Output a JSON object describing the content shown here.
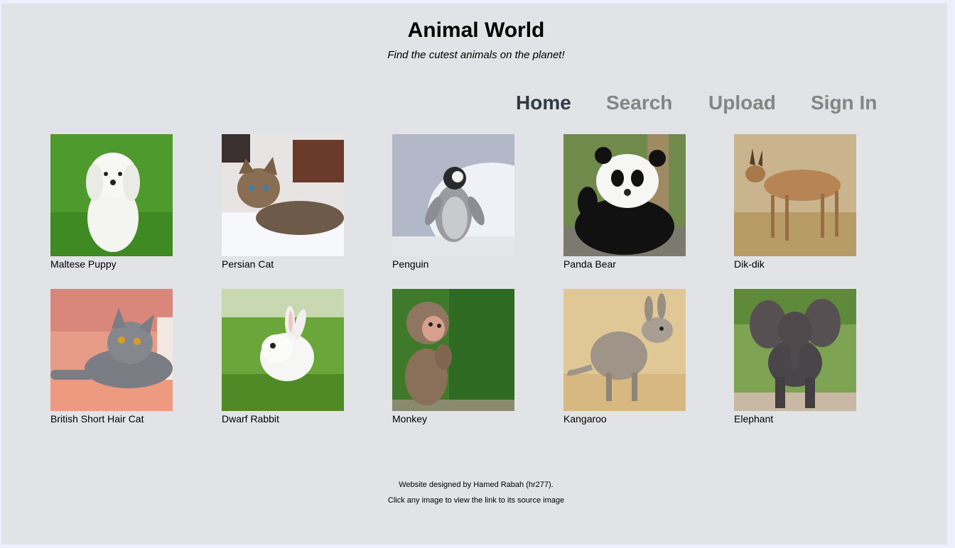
{
  "header": {
    "title": "Animal World",
    "tagline": "Find the cutest animals on the planet!"
  },
  "nav": {
    "items": [
      {
        "label": "Home",
        "active": true
      },
      {
        "label": "Search",
        "active": false
      },
      {
        "label": "Upload",
        "active": false
      },
      {
        "label": "Sign In",
        "active": false
      }
    ]
  },
  "gallery": {
    "items": [
      {
        "caption": "Maltese Puppy"
      },
      {
        "caption": "Persian Cat"
      },
      {
        "caption": "Penguin"
      },
      {
        "caption": "Panda Bear"
      },
      {
        "caption": "Dik-dik"
      },
      {
        "caption": "British Short Hair Cat"
      },
      {
        "caption": "Dwarf Rabbit"
      },
      {
        "caption": "Monkey"
      },
      {
        "caption": "Kangaroo"
      },
      {
        "caption": "Elephant"
      }
    ]
  },
  "footer": {
    "credit": "Website designed by Hamed Rabah (hr277).",
    "note": "Click any image to view the link to its source image"
  },
  "colors": {
    "background": "#e2e3e6",
    "nav_active": "#333a44",
    "nav_inactive": "#858585"
  }
}
